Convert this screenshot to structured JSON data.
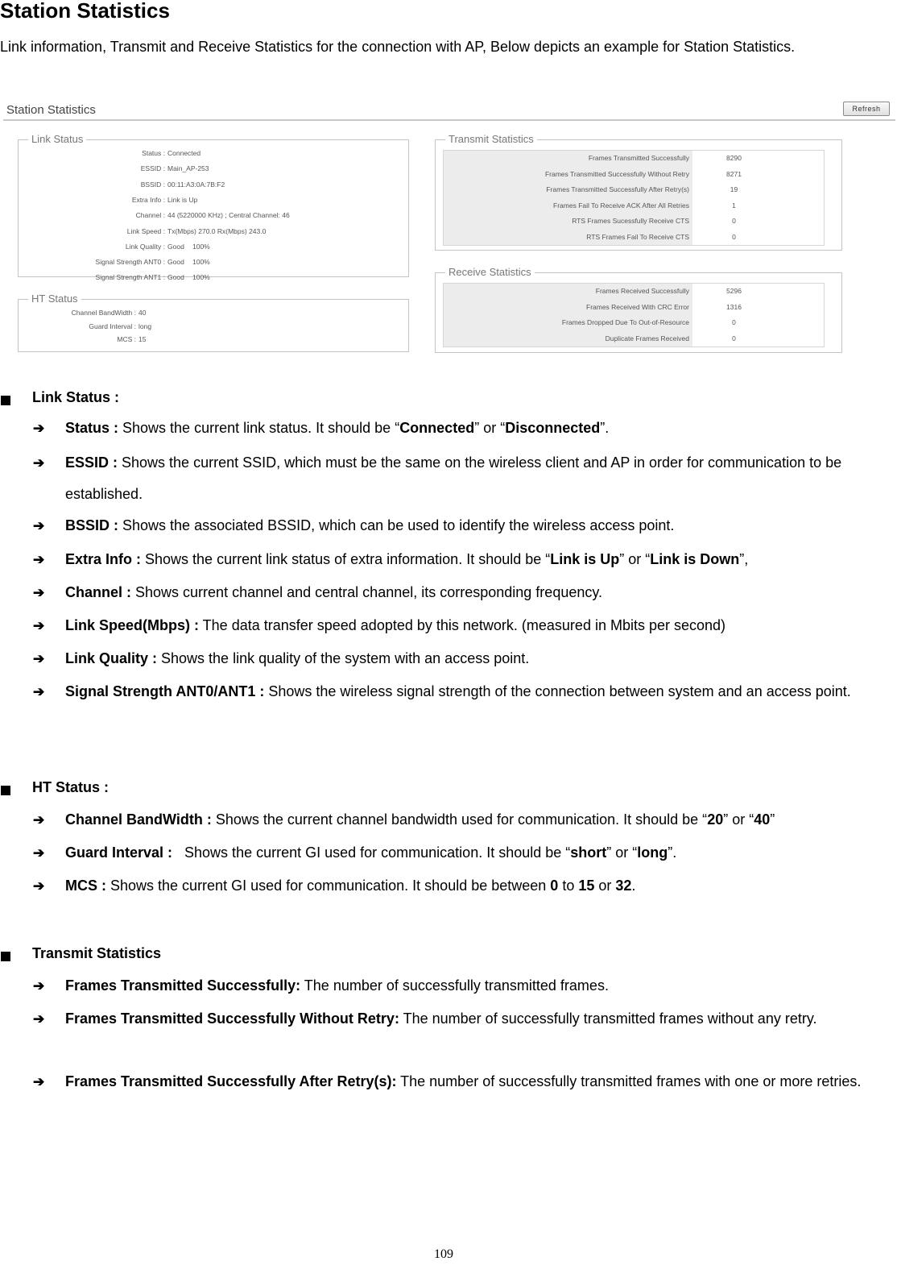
{
  "heading": "Station Statistics",
  "intro": "Link information, Transmit and Receive Statistics for the connection with AP, Below depicts an example for Station Statistics.",
  "screenshot": {
    "title": "Station Statistics",
    "refresh_label": "Refresh",
    "link_status": {
      "legend": "Link Status",
      "rows": [
        {
          "key": "Status :",
          "value": "Connected",
          "pct": ""
        },
        {
          "key": "ESSID :",
          "value": "Main_AP-253",
          "pct": ""
        },
        {
          "key": "BSSID :",
          "value": "00:11:A3:0A:7B:F2",
          "pct": ""
        },
        {
          "key": "Extra Info :",
          "value": "Link is Up",
          "pct": ""
        },
        {
          "key": "Channel :",
          "value": "44 (5220000 KHz) ; Central Channel: 46",
          "pct": ""
        },
        {
          "key": "Link Speed :",
          "value": "Tx(Mbps)  270.0    Rx(Mbps)  243.0",
          "pct": ""
        },
        {
          "key": "Link Quality :",
          "value": "Good",
          "pct": "100%"
        },
        {
          "key": "Signal Strength ANT0 :",
          "value": "Good",
          "pct": "100%"
        },
        {
          "key": "Signal Strength ANT1 :",
          "value": "Good",
          "pct": "100%"
        }
      ]
    },
    "ht_status": {
      "legend": "HT Status",
      "rows": [
        {
          "key": "Channel BandWidth :",
          "value": "40"
        },
        {
          "key": "Guard Interval :",
          "value": "long"
        },
        {
          "key": "MCS :",
          "value": "15"
        }
      ]
    },
    "transmit_statistics": {
      "legend": "Transmit Statistics",
      "rows": [
        {
          "label": "Frames Transmitted Successfully",
          "value": "8290"
        },
        {
          "label": "Frames Transmitted Successfully Without Retry",
          "value": "8271"
        },
        {
          "label": "Frames Transmitted Successfully After Retry(s)",
          "value": "19"
        },
        {
          "label": "Frames Fail To Receive ACK After All Retries",
          "value": "1"
        },
        {
          "label": "RTS Frames Sucessfully Receive CTS",
          "value": "0"
        },
        {
          "label": "RTS Frames Fail To Receive CTS",
          "value": "0"
        }
      ]
    },
    "receive_statistics": {
      "legend": "Receive Statistics",
      "rows": [
        {
          "label": "Frames Received Successfully",
          "value": "5296"
        },
        {
          "label": "Frames Received With CRC Error",
          "value": "1316"
        },
        {
          "label": "Frames Dropped Due To Out-of-Resource",
          "value": "0"
        },
        {
          "label": "Duplicate Frames Received",
          "value": "0"
        }
      ]
    }
  },
  "sections": {
    "link_status": {
      "title": "Link Status :",
      "items": [
        {
          "term": "Status :",
          "parts": [
            " Shows the current link status. It should be “",
            {
              "b": "Connected"
            },
            "” or “",
            {
              "b": "Disconnected"
            },
            "”."
          ]
        },
        {
          "term": "ESSID :",
          "parts": [
            " Shows the current SSID, which must be the same on the wireless client and AP in order for communication to be established."
          ]
        },
        {
          "term": "BSSID :",
          "parts": [
            " Shows the associated BSSID, which can be used to identify the wireless access point."
          ]
        },
        {
          "term": "Extra Info :",
          "parts": [
            " Shows the current link status of extra information. It should be “",
            {
              "b": "Link is Up"
            },
            "” or “",
            {
              "b": "Link is Down"
            },
            "”,"
          ]
        },
        {
          "term": "Channel :",
          "parts": [
            " Shows current channel and central channel, its corresponding frequency."
          ]
        },
        {
          "term": "Link Speed(Mbps) :",
          "parts": [
            " The data transfer speed adopted by this network. (measured in Mbits per second)"
          ]
        },
        {
          "term": "Link Quality :",
          "parts": [
            " Shows the link quality of the system with an access point."
          ]
        },
        {
          "term": "Signal Strength ANT0/ANT1 :",
          "parts": [
            " Shows the wireless signal strength of the connection between system and an access point."
          ]
        }
      ]
    },
    "ht_status": {
      "title": "HT Status :",
      "items": [
        {
          "term": "Channel BandWidth :",
          "parts": [
            " Shows the current channel bandwidth used for communication. It should be “",
            {
              "b": "20"
            },
            "” or “",
            {
              "b": "40"
            },
            "”"
          ]
        },
        {
          "term": "Guard Interval :",
          "parts": [
            "   Shows the current GI used for communication. It should be “",
            {
              "b": "short"
            },
            "” or “",
            {
              "b": "long"
            },
            "”."
          ]
        },
        {
          "term": "MCS :",
          "parts": [
            " Shows the current GI used for communication. It should be between ",
            {
              "b": "0"
            },
            " to ",
            {
              "b": "15"
            },
            " or ",
            {
              "b": "32"
            },
            "."
          ]
        }
      ]
    },
    "transmit_statistics": {
      "title": "Transmit Statistics",
      "items": [
        {
          "term": "Frames Transmitted Successfully:",
          "parts": [
            " The number of successfully transmitted frames."
          ]
        },
        {
          "term": "Frames Transmitted Successfully Without Retry:",
          "parts": [
            " The number of successfully transmitted frames without any retry."
          ]
        },
        {
          "term": "Frames Transmitted Successfully After Retry(s):",
          "parts": [
            " The number of successfully transmitted frames with one or more retries."
          ]
        }
      ]
    }
  },
  "icons": {
    "section_bullet": "square-bullet-icon",
    "item_bullet": "arrow-right-icon"
  },
  "page_number": "109"
}
